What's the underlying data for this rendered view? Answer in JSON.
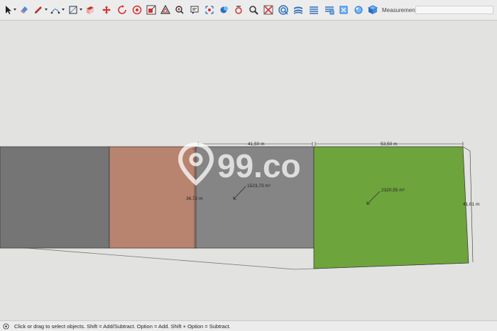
{
  "toolbar": {
    "tools": [
      {
        "name": "select-tool",
        "icon": "arrow-cursor-icon"
      },
      {
        "name": "eraser-tool",
        "icon": "eraser-icon"
      },
      {
        "name": "line-tool",
        "icon": "pencil-icon"
      },
      {
        "name": "arc-tool",
        "icon": "arc-icon"
      },
      {
        "name": "rectangle-tool",
        "icon": "rectangle-icon"
      },
      {
        "name": "push-pull-tool",
        "icon": "push-pull-icon"
      },
      {
        "name": "move-tool",
        "icon": "move-arrows-icon"
      },
      {
        "name": "rotate-tool",
        "icon": "rotate-icon"
      },
      {
        "name": "scale-tool",
        "icon": "scale-icon"
      },
      {
        "name": "offset-tool",
        "icon": "offset-icon"
      },
      {
        "name": "paint-bucket-tool",
        "icon": "paint-bucket-icon"
      },
      {
        "name": "text-tool",
        "icon": "text-icon"
      },
      {
        "name": "orbit-tool",
        "icon": "orbit-icon"
      },
      {
        "name": "pan-tool",
        "icon": "hand-icon"
      },
      {
        "name": "position-camera-tool",
        "icon": "camera-icon"
      },
      {
        "name": "zoom-tool",
        "icon": "magnifier-icon"
      },
      {
        "name": "zoom-extents-tool",
        "icon": "zoom-extents-icon"
      },
      {
        "name": "warehouse-tool",
        "icon": "warehouse-icon"
      },
      {
        "name": "sandbox-tool",
        "icon": "layers-icon"
      },
      {
        "name": "styles-tool",
        "icon": "styles-icon"
      },
      {
        "name": "components-tool",
        "icon": "components-icon"
      },
      {
        "name": "materials-tool",
        "icon": "materials-icon"
      },
      {
        "name": "extension-tool",
        "icon": "cube-icon"
      }
    ],
    "measurements_label": "Measurements",
    "measurements_value": ""
  },
  "canvas": {
    "dimensions": {
      "top_middle": "41,50 m",
      "top_right": "53,50 m",
      "left_height": "36,72 m",
      "right_height": "41,61 m"
    },
    "areas": {
      "gray_parcel": "1523,73 m²",
      "green_parcel": "2320,55 m²"
    },
    "colors": {
      "dark_gray": "#757575",
      "salmon": "#b8846f",
      "mid_gray": "#858585",
      "green": "#6ea43c",
      "background": "#e2e2e0"
    },
    "watermark_text": "99.co"
  },
  "status": {
    "text": "Click or drag to select objects. Shift = Add/Subtract. Option = Add. Shift + Option = Subtract."
  }
}
